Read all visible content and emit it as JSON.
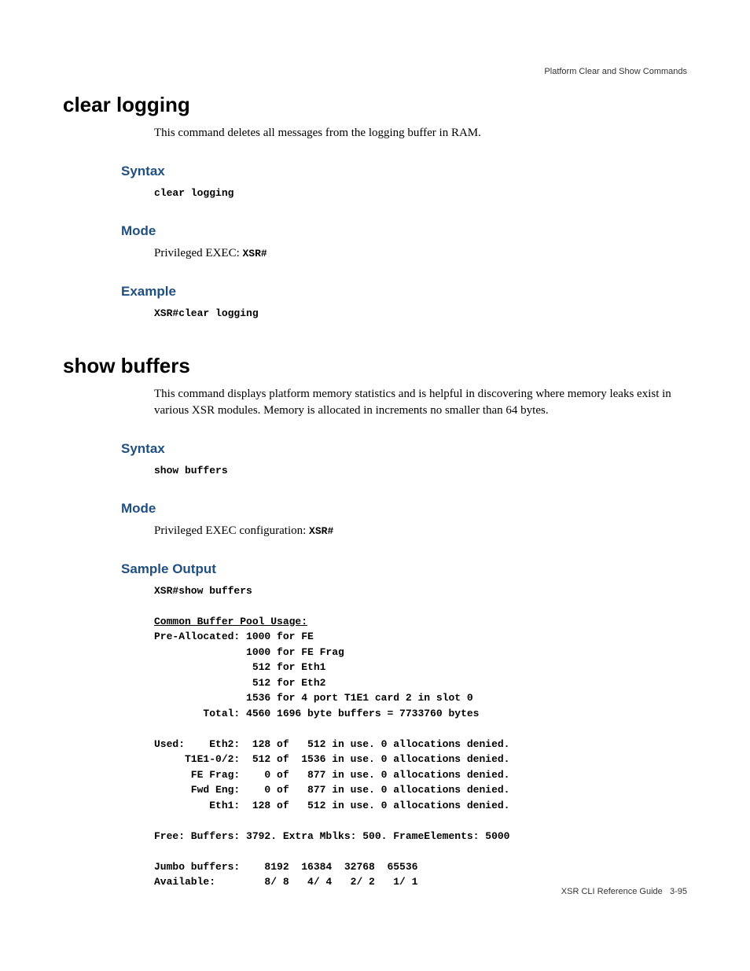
{
  "header": {
    "section": "Platform Clear and Show Commands"
  },
  "footer": {
    "book": "XSR CLI Reference Guide",
    "page": "3-95"
  },
  "commands": [
    {
      "title": "clear logging",
      "desc": "This command deletes all messages from the logging buffer in RAM.",
      "syntax_h": "Syntax",
      "syntax": "clear logging",
      "mode_h": "Mode",
      "mode_prefix": "Privileged EXEC: ",
      "mode_code": "XSR#",
      "example_h": "Example",
      "example": "XSR#clear logging"
    },
    {
      "title": "show buffers",
      "desc": "This command displays platform memory statistics and is helpful in discovering where memory leaks exist in various XSR modules. Memory is allocated in increments no smaller than 64 bytes.",
      "syntax_h": "Syntax",
      "syntax": "show buffers",
      "mode_h": "Mode",
      "mode_prefix": "Privileged EXEC configuration: ",
      "mode_code": "XSR#",
      "sample_h": "Sample Output",
      "sample_cmd": "XSR#show buffers",
      "sample_lines": {
        "header": "Common Buffer Pool Usage:",
        "l0": "Pre-Allocated: 1000 for FE",
        "l1": "               1000 for FE Frag",
        "l2": "                512 for Eth1",
        "l3": "                512 for Eth2",
        "l4": "               1536 for 4 port T1E1 card 2 in slot 0",
        "l5": "        Total: 4560 1696 byte buffers = 7733760 bytes",
        "l6": "",
        "l7": "Used:    Eth2:  128 of   512 in use. 0 allocations denied.",
        "l8": "     T1E1-0/2:  512 of  1536 in use. 0 allocations denied.",
        "l9": "      FE Frag:    0 of   877 in use. 0 allocations denied.",
        "l10": "      Fwd Eng:    0 of   877 in use. 0 allocations denied.",
        "l11": "         Eth1:  128 of   512 in use. 0 allocations denied.",
        "l12": "",
        "l13": "Free: Buffers: 3792. Extra Mblks: 500. FrameElements: 5000",
        "l14": "",
        "l15": "Jumbo buffers:    8192  16384  32768  65536",
        "l16": "Available:        8/ 8   4/ 4   2/ 2   1/ 1"
      }
    }
  ]
}
